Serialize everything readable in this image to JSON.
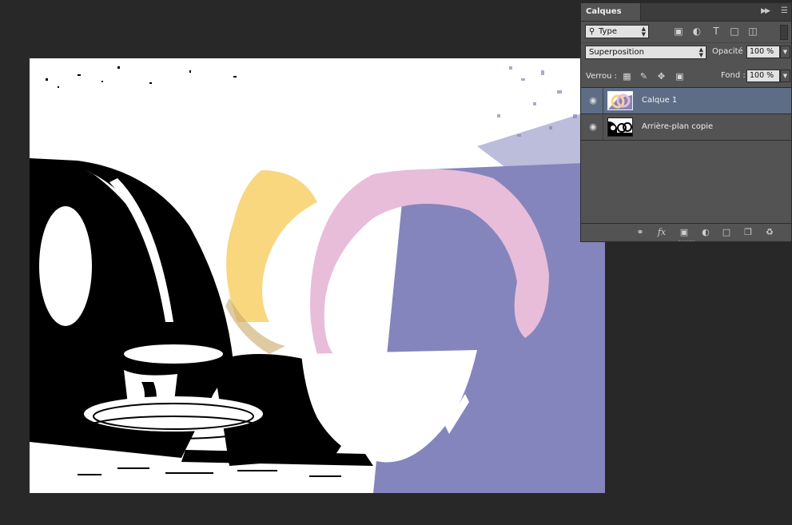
{
  "panel": {
    "tab_label": "Calques",
    "collapse_icon": "double-chevron-right-icon",
    "menu_icon": "panel-menu-icon"
  },
  "filter": {
    "kind_value": "Type",
    "icons": [
      "pixel-layer-filter-icon",
      "adjustment-layer-filter-icon",
      "type-layer-filter-icon",
      "shape-layer-filter-icon",
      "smart-object-filter-icon"
    ]
  },
  "blend": {
    "mode_value": "Superposition",
    "opacity_label": "Opacité :",
    "opacity_value": "100 %"
  },
  "lock": {
    "label": "Verrou :",
    "fill_label": "Fond :",
    "fill_value": "100 %",
    "icons": [
      "lock-transparent-pixels-icon",
      "lock-image-pixels-icon",
      "lock-position-icon",
      "lock-all-icon"
    ]
  },
  "layers": [
    {
      "name": "Calque 1",
      "selected": true,
      "visible": true
    },
    {
      "name": "Arrière-plan copie",
      "selected": false,
      "visible": true
    }
  ],
  "footer_icons": [
    "link-layers-icon",
    "fx-icon",
    "add-mask-icon",
    "new-adjustment-layer-icon",
    "new-group-icon",
    "new-layer-icon",
    "delete-layer-icon"
  ],
  "colors": {
    "workspace": "#282828",
    "panel": "#535353",
    "selected_layer": "#5e6d86",
    "purple_overlay": "#8585bd",
    "yellow": "#f9d77f",
    "pink": "#e8bdd9"
  }
}
